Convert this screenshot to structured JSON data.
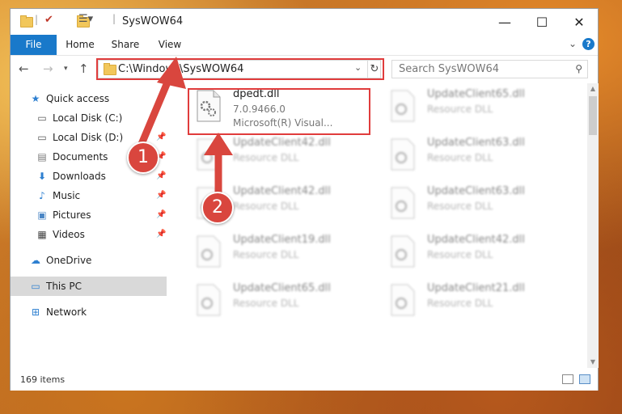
{
  "window": {
    "title": "SysWOW64",
    "controls": {
      "minimize": "—",
      "maximize": "☐",
      "close": "✕"
    }
  },
  "ribbon": {
    "tabs": [
      {
        "label": "File"
      },
      {
        "label": "Home"
      },
      {
        "label": "Share"
      },
      {
        "label": "View"
      }
    ],
    "help": "?"
  },
  "address": {
    "path": "C:\\Windows\\SysWOW64",
    "search_placeholder": "Search SysWOW64"
  },
  "sidebar": {
    "items": [
      {
        "label": "Quick access",
        "icon": "star-icon",
        "pinned": false
      },
      {
        "label": "Local Disk (C:)",
        "icon": "drive-icon",
        "pinned": false
      },
      {
        "label": "Local Disk (D:)",
        "icon": "drive-icon",
        "pinned": true
      },
      {
        "label": "Documents",
        "icon": "documents-icon",
        "pinned": true
      },
      {
        "label": "Downloads",
        "icon": "download-icon",
        "pinned": true
      },
      {
        "label": "Music",
        "icon": "music-icon",
        "pinned": true
      },
      {
        "label": "Pictures",
        "icon": "pictures-icon",
        "pinned": true
      },
      {
        "label": "Videos",
        "icon": "videos-icon",
        "pinned": true
      },
      {
        "label": "OneDrive",
        "icon": "cloud-icon",
        "pinned": false
      },
      {
        "label": "This PC",
        "icon": "computer-icon",
        "pinned": false,
        "selected": true
      },
      {
        "label": "Network",
        "icon": "network-icon",
        "pinned": false
      }
    ]
  },
  "files": {
    "highlighted": {
      "name": "dpedt.dll",
      "version": "7.0.9466.0",
      "company": "Microsoft(R) Visual..."
    },
    "others": [
      {
        "name": "UpdateClient65.dll",
        "type": "Resource DLL"
      },
      {
        "name": "UpdateClient42.dll",
        "type": "Resource DLL"
      },
      {
        "name": "UpdateClient63.dll",
        "type": "Resource DLL"
      },
      {
        "name": "UpdateClient42.dll",
        "type": "Resource DLL"
      },
      {
        "name": "UpdateClient63.dll",
        "type": "Resource DLL"
      },
      {
        "name": "UpdateClient19.dll",
        "type": "Resource DLL"
      },
      {
        "name": "UpdateClient42.dll",
        "type": "Resource DLL"
      },
      {
        "name": "UpdateClient65.dll",
        "type": "Resource DLL"
      },
      {
        "name": "UpdateClient21.dll",
        "type": "Resource DLL"
      }
    ]
  },
  "status": {
    "item_count": "169 items"
  },
  "callouts": {
    "one": "1",
    "two": "2",
    "color": "#d9463e"
  }
}
